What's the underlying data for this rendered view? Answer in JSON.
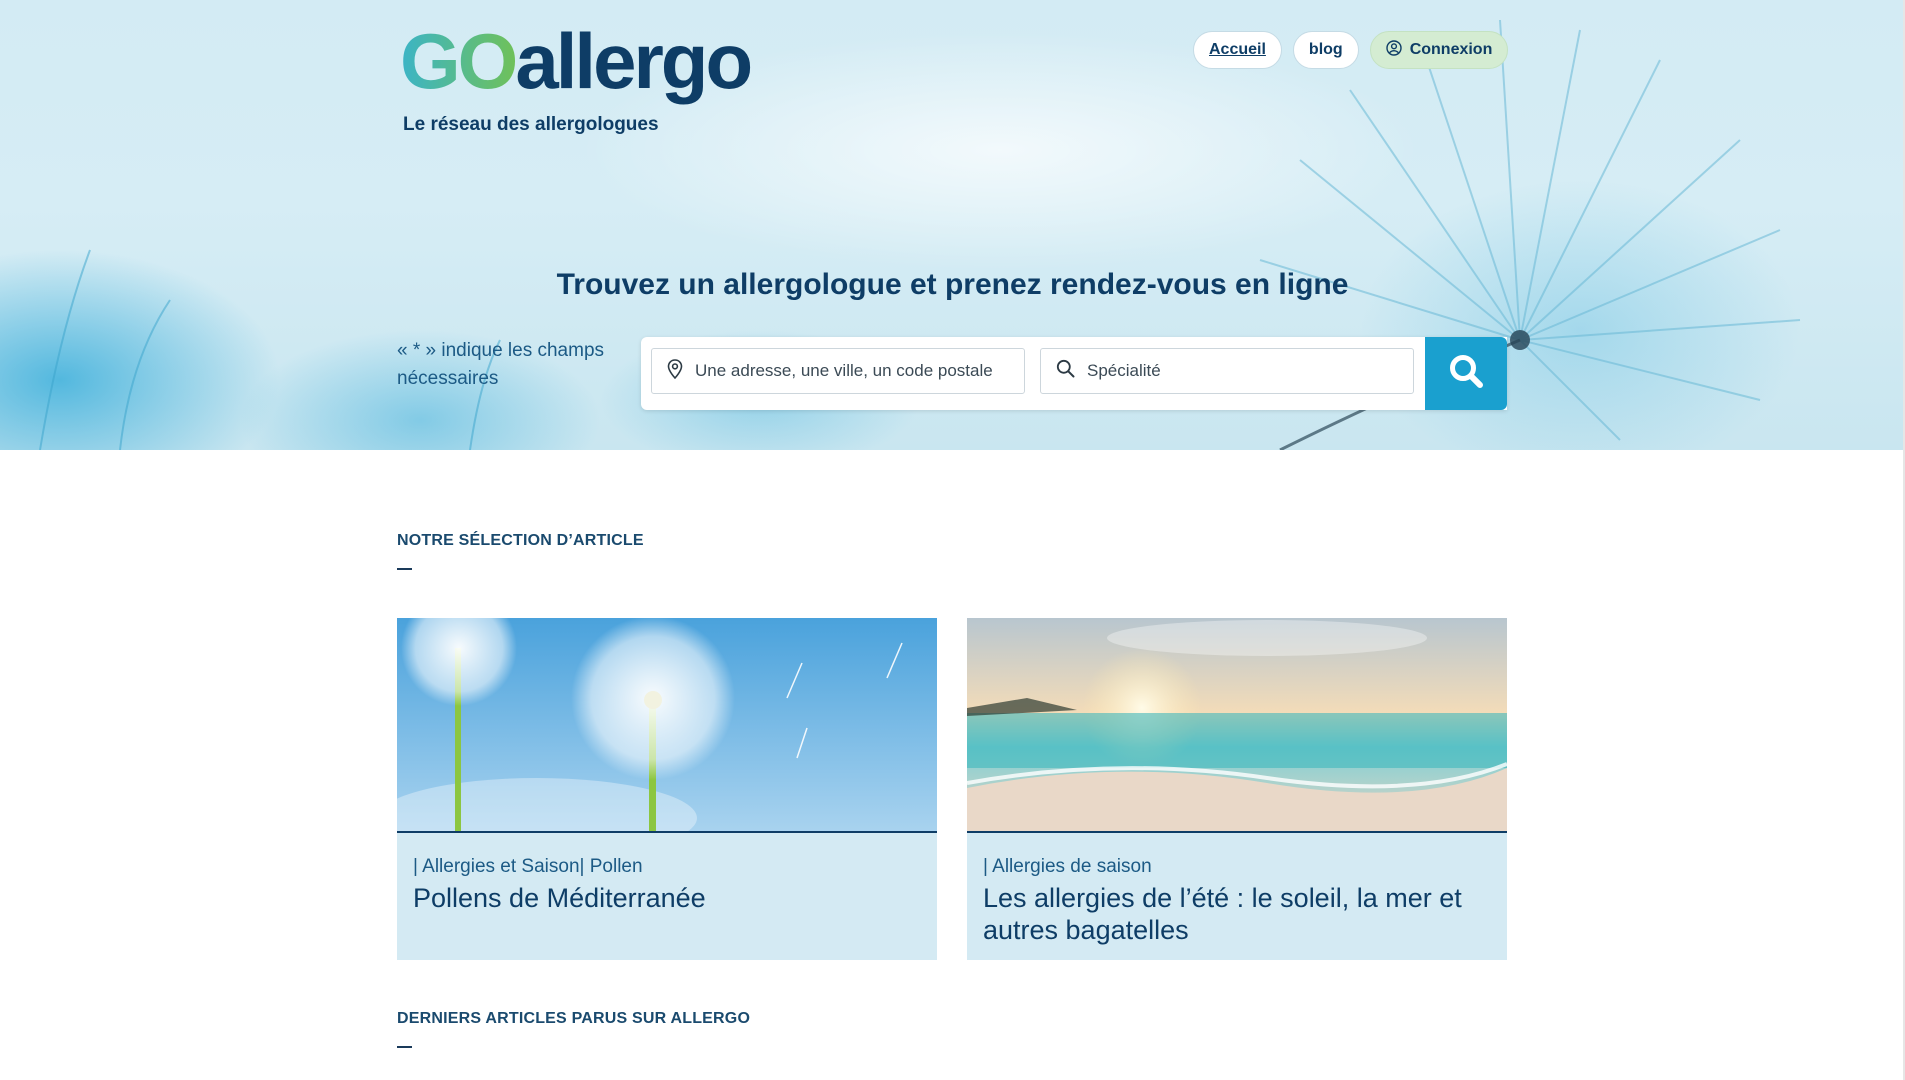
{
  "brand": {
    "logo_go": "GO",
    "logo_allergo": "allergo",
    "tagline": "Le réseau des allergologues"
  },
  "nav": {
    "home": "Accueil",
    "blog": "blog",
    "login": "Connexion"
  },
  "hero": {
    "title": "Trouvez un allergologue et prenez rendez-vous en ligne",
    "required_hint": "« * » indique les champs nécessaires"
  },
  "search": {
    "address_placeholder": "Une adresse, une ville, un code postale",
    "specialty_placeholder": "Spécialité"
  },
  "selection": {
    "heading": "NOTRE SÉLECTION D’ARTICLE",
    "articles": [
      {
        "category": "| Allergies et Saison| Pollen",
        "title": "Pollens de Méditerranée",
        "image": "dandelion-photo"
      },
      {
        "category": "| Allergies de saison",
        "title": "Les allergies de l’été : le soleil, la mer et autres bagatelles",
        "image": "beach-sunset-photo"
      }
    ]
  },
  "latest": {
    "heading": "DERNIERS ARTICLES PARUS SUR ALLERGO"
  },
  "colors": {
    "brand_navy": "#0e3d66",
    "search_button": "#1aa0cf",
    "card_bg": "#d4eaf3",
    "login_bg": "#d4ecd2"
  }
}
